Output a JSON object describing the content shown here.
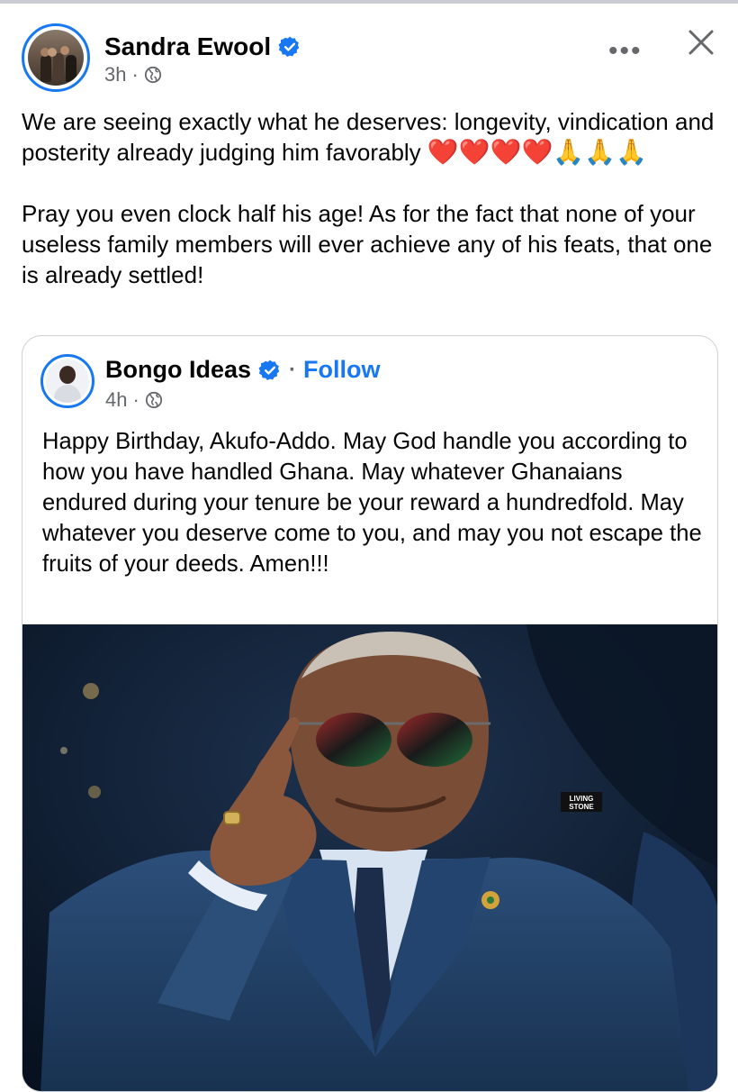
{
  "post": {
    "author": "Sandra Ewool",
    "time": "3h",
    "separator": "·",
    "more_label": "•••",
    "paragraph1_text": "We are seeing exactly what he deserves: longevity, vindication and posterity already judging him favorably",
    "paragraph1_emojis": "❤️❤️❤️❤️🙏🙏🙏",
    "paragraph2": "Pray you even clock half his age! As for the fact that none of your useless family members will ever achieve any of his feats, that one is already settled!"
  },
  "shared": {
    "author": "Bongo Ideas",
    "separator": "·",
    "follow_label": "Follow",
    "time": "4h",
    "text": "Happy Birthday, Akufo-Addo. May God handle you according to how you have handled Ghana. May whatever Ghanaians endured during your tenure be your reward a hundredfold. May whatever you deserve come to you, and may you not escape the fruits of your deeds. Amen!!!",
    "photo_watermark": "LIVING STONE"
  },
  "colors": {
    "accent": "#1877f2",
    "secondary_text": "#65676b"
  },
  "icons": [
    "verified-badge-icon",
    "globe-icon",
    "more-options-icon",
    "close-icon"
  ]
}
